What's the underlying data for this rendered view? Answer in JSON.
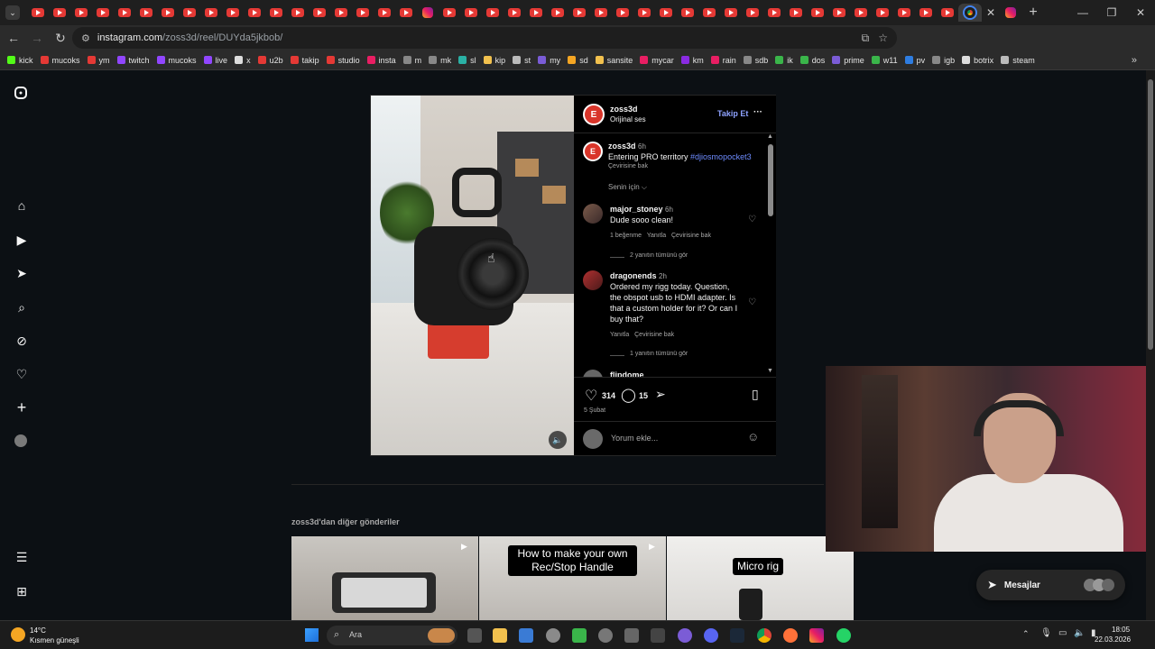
{
  "browser": {
    "url_host": "instagram.com",
    "url_path": "/zoss3d/reel/DUYda5jkbob/",
    "tab_close": "✕",
    "new_tab": "+"
  },
  "bookmarks": [
    "kick",
    "mucoks",
    "ym",
    "twitch",
    "mucoks",
    "live",
    "x",
    "u2b",
    "takip",
    "studio",
    "insta",
    "m",
    "mk",
    "sl",
    "kip",
    "st",
    "my",
    "sd",
    "sansite",
    "mycar",
    "km",
    "rain",
    "sdb",
    "ik",
    "dos",
    "prime",
    "w11",
    "pv",
    "igb",
    "botrix",
    "steam"
  ],
  "post": {
    "username": "zoss3d",
    "audio": "Orijinal ses",
    "follow": "Takip Et",
    "more": "···",
    "caption_user": "zoss3d",
    "caption_time": "6h",
    "caption_text": "Entering PRO territory",
    "caption_tag": "#djiosmopocket3",
    "see_translation": "Çevirisine bak",
    "sort": "Senin için",
    "likes": "314",
    "comments_count": "15",
    "date": "5 Şubat",
    "add_comment_placeholder": "Yorum ekle..."
  },
  "comments": [
    {
      "user": "major_stoney",
      "time": "6h",
      "text": "Dude sooo clean!",
      "likes": "1 beğenme",
      "reply": "Yanıtla",
      "translate": "Çevirisine bak",
      "view_replies": "2 yanıtın tümünü gör"
    },
    {
      "user": "dragonends",
      "time": "2h",
      "text_lines": [
        "Ordered my rigg today. Question,",
        "the obspot usb to HDMI adapter. Is",
        "that a custom holder for it? Or can I",
        "buy that?"
      ],
      "reply": "Yanıtla",
      "translate": "Çevirisine bak",
      "view_replies": "1 yanıtın tümünü gör"
    },
    {
      "user": "flipdome"
    }
  ],
  "more_posts": {
    "heading_user": "zoss3d",
    "heading_suffix": "'dan diğer gönderiler",
    "captions": [
      "How to make your own Rec/Stop Handle",
      "Micro rig"
    ]
  },
  "messages": {
    "label": "Mesajlar"
  },
  "taskbar": {
    "temp": "14°C",
    "weather": "Kısmen güneşli",
    "search": "Ara",
    "time": "18:05",
    "date": "22.03.2026"
  },
  "colors": {
    "instagram_blue": "#0095f6",
    "hashtag": "#6e8cff",
    "bg": "#0c1014"
  }
}
